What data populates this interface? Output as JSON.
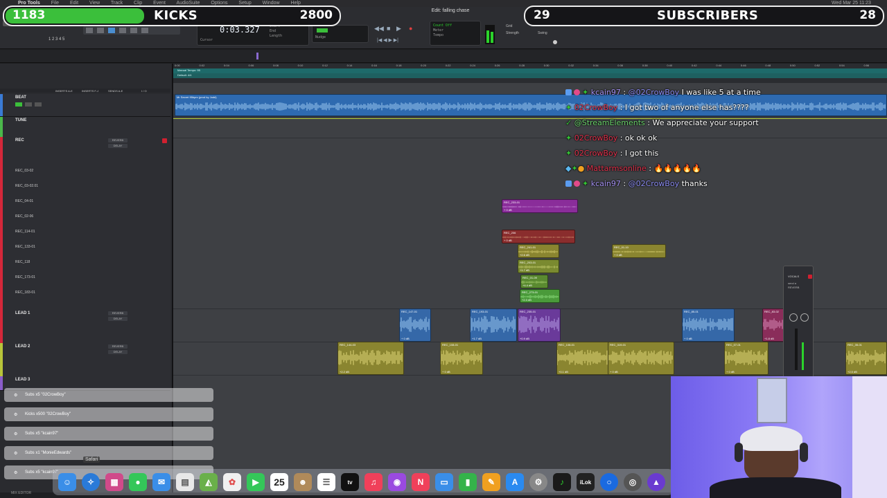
{
  "menubar": {
    "items": [
      "Pro Tools",
      "File",
      "Edit",
      "View",
      "Track",
      "Clip",
      "Event",
      "AudioSuite",
      "Options",
      "Setup",
      "Window",
      "Help"
    ],
    "window_title": "Edit: falling chase",
    "clock": "Wed Mar 25 11:23 PM"
  },
  "transport": {
    "counter": "0:03.327",
    "start_label": "Start",
    "end_label": "End",
    "length_label": "Length",
    "nudge_label": "Nudge",
    "cursor_label": "Cursor",
    "grid_label": "Grid",
    "strength_label": "Strength",
    "swing_label": "Swing",
    "tempo_label": "Tempo",
    "meter_label": "Meter",
    "count_off_label": "Count Off"
  },
  "overlay": {
    "left": {
      "count": "1183",
      "title": "KICKS",
      "goal": "2800"
    },
    "right": {
      "count": "29",
      "title": "SUBSCRIBERS",
      "goal": "28"
    }
  },
  "ruler": {
    "rows": [
      "Min:Secs",
      "Tempo",
      "Meter",
      "Markers"
    ],
    "tempo_text": "Manual Tempo: 95",
    "meter_text": "Default: 4/4",
    "ticks": [
      "0:00",
      "0:02",
      "0:04",
      "0:06",
      "0:08",
      "0:10",
      "0:12",
      "0:14",
      "0:16",
      "0:18",
      "0:20",
      "0:22",
      "0:24",
      "0:26",
      "0:28",
      "0:30",
      "0:32",
      "0:34",
      "0:36",
      "0:38",
      "0:40",
      "0:42",
      "0:44",
      "0:46",
      "0:48",
      "0:50",
      "0:52",
      "0:54",
      "0:56"
    ]
  },
  "headers": {
    "col_inserts_a": "INSERTS A-E",
    "col_inserts_b": "INSERTS F-J",
    "col_sends": "SENDS A-E",
    "col_io": "I / O"
  },
  "tracks": [
    {
      "name": "BEAT",
      "color": "#3a7bd5",
      "ins": [
        "",
        ""
      ],
      "subs": [],
      "clip_label": "Mr Secret 95bpm (prod by Jodd)"
    },
    {
      "name": "TUNE",
      "color": "#4bb84b",
      "ins": [
        "",
        ""
      ],
      "subs": []
    },
    {
      "name": "REC",
      "color": "#d4273a",
      "ins": [
        "REVERB",
        "DELAY"
      ],
      "subs": [
        "REC_03-02",
        "REC_03-02.01",
        "REC_04-01",
        "REC_02-06",
        "REC_114-01",
        "REC_133-01",
        "REC_118",
        "REC_173-01",
        "REC_183-01"
      ]
    },
    {
      "name": "LEAD 1",
      "color": "#d4273a",
      "ins": [
        "REVERB",
        "DELAY"
      ],
      "subs": []
    },
    {
      "name": "LEAD 2",
      "color": "#b8c43a",
      "ins": [
        "REVERB",
        "DELAY"
      ],
      "subs": []
    },
    {
      "name": "LEAD 3",
      "color": "#8a5cc9",
      "ins": [
        "",
        ""
      ],
      "subs": []
    }
  ],
  "clips": [
    {
      "label": "REC_233-01",
      "db": "+ 0 dB",
      "color": "#8a2d9a",
      "wave": "#c58ad6"
    },
    {
      "label": "REC_206",
      "db": "+ 0 dB",
      "color": "#8a2d2d",
      "wave": "#c98a6a"
    },
    {
      "label": "REC_241-01",
      "db": "+2.6 dB",
      "color": "#8a8530",
      "wave": "#d8d070"
    },
    {
      "label": "REC_01-10",
      "db": "+ 0 dB",
      "color": "#8a8530",
      "wave": "#d8d070"
    },
    {
      "label": "REC_203-01",
      "db": "+1.7 dB",
      "color": "#7a8a30",
      "wave": "#c8d070"
    },
    {
      "label": "REC_01-09",
      "db": "+4.4 dB",
      "color": "#5a8a30",
      "wave": "#a8d070"
    },
    {
      "label": "REC_273-01",
      "db": "+2.3 dB",
      "color": "#4a9a3a",
      "wave": "#90e080"
    },
    {
      "label": "REC_147-01",
      "db": "+ 0 dB",
      "color": "#3568a8",
      "wave": "#9cc8f0"
    },
    {
      "label": "REC_193-01",
      "db": "+1.7 dB",
      "color": "#3568a8",
      "wave": "#9cc8f0"
    },
    {
      "label": "REC_235-01",
      "db": "+0.9 dB",
      "color": "#6a3a9a",
      "wave": "#b8a0e8"
    },
    {
      "label": "REC_85-01",
      "db": "+ 0 dB",
      "color": "#3568a8",
      "wave": "#9cc8f0"
    },
    {
      "label": "REC_83-02",
      "db": "+1.8 dB",
      "color": "#8a2d5a",
      "wave": "#d88ab8"
    },
    {
      "label": "REC_144-03",
      "db": "+2.2 dB",
      "color": "#8a8530",
      "wave": "#e0d878"
    },
    {
      "label": "REC_108-01",
      "db": "+ 0 dB",
      "color": "#8a8530",
      "wave": "#e0d878"
    },
    {
      "label": "REC_108-01",
      "db": "+0.1 dB",
      "color": "#8a8530",
      "wave": "#e0d878"
    },
    {
      "label": "REC_319-01",
      "db": "+ 0 dB",
      "color": "#8a8530",
      "wave": "#e0d878"
    },
    {
      "label": "REC_07-01",
      "db": "+ 0 dB",
      "color": "#8a8530",
      "wave": "#e0d878"
    },
    {
      "label": "REC_35-01",
      "db": "+2.0 dB",
      "color": "#8a8530",
      "wave": "#e0d878"
    }
  ],
  "chat": [
    {
      "user": "kcain97",
      "user_color": "#a38ff0",
      "mention": "@02CrowBoy",
      "message": "I was like 5 at a time"
    },
    {
      "user": "02CrowBoy",
      "user_color": "#e0304a",
      "mention": "",
      "message": "I got two of anyone else has????"
    },
    {
      "user": "@StreamElements",
      "user_color": "#6ad26a",
      "mention": "",
      "message": "We appreciate your support"
    },
    {
      "user": "02CrowBoy",
      "user_color": "#e0304a",
      "mention": "",
      "message": "ok ok ok"
    },
    {
      "user": "02CrowBoy",
      "user_color": "#e0304a",
      "mention": "",
      "message": "I got this"
    },
    {
      "user": "Mattarmsonline",
      "user_color": "#e0304a",
      "mention": "",
      "message": "🔥🔥🔥🔥🔥"
    },
    {
      "user": "kcain97",
      "user_color": "#a38ff0",
      "mention": "@02CrowBoy",
      "message": "thanks"
    }
  ],
  "notifications": [
    "Subs x5 \"02CrowBoy\"",
    "Kicks x500 \"02CrowBoy\"",
    "Subs x5 \"kcain97\"",
    "Subs x1 \"MonieEdwards\"",
    "Subs x5 \"kcain97\""
  ],
  "mini_mixer": {
    "title": "VOCALS",
    "send": "send a",
    "insert": "REVERB"
  },
  "dock": {
    "calendar_day": "25",
    "tooltip": "Safari",
    "apps": [
      "finder-icon",
      "safari-icon",
      "launchpad-icon",
      "messages-icon",
      "mail-icon",
      "files-icon",
      "maps-icon",
      "photos-icon",
      "facetime-icon",
      "calendar-icon",
      "contacts-icon",
      "reminders-icon",
      "appletv-icon",
      "music-icon",
      "podcasts-icon",
      "news-icon",
      "keynote-icon",
      "numbers-icon",
      "pages-icon",
      "appstore-icon",
      "settings-icon",
      "protools-icon",
      "ilok-icon",
      "circle-app-icon",
      "audio-app-icon",
      "avid-icon"
    ]
  },
  "bottom_strip": "MIX  EDITOR"
}
